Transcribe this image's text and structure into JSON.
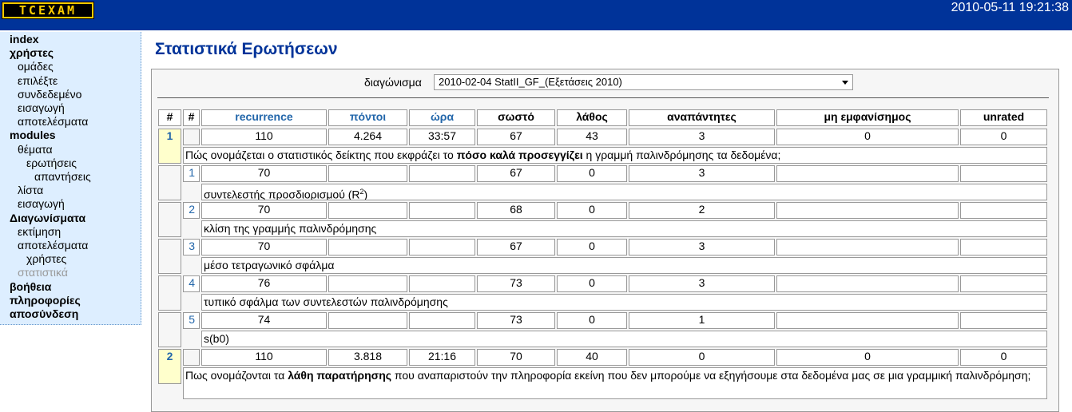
{
  "header": {
    "logo": "TCEXAM",
    "datetime": "2010-05-11 19:21:38"
  },
  "menu": [
    {
      "label": "index",
      "bold": true,
      "indent": 0
    },
    {
      "label": "χρήστες",
      "bold": true,
      "indent": 0
    },
    {
      "label": "ομάδες",
      "indent": 1
    },
    {
      "label": "επιλέξτε",
      "indent": 1
    },
    {
      "label": "συνδεδεμένο",
      "indent": 1
    },
    {
      "label": "εισαγωγή",
      "indent": 1
    },
    {
      "label": "αποτελέσματα",
      "indent": 1
    },
    {
      "label": "modules",
      "bold": true,
      "indent": 0
    },
    {
      "label": "θέματα",
      "indent": 1
    },
    {
      "label": "ερωτήσεις",
      "indent": 2
    },
    {
      "label": "απαντήσεις",
      "indent": 3
    },
    {
      "label": "λίστα",
      "indent": 1
    },
    {
      "label": "εισαγωγή",
      "indent": 1
    },
    {
      "label": "Διαγωνίσματα",
      "bold": true,
      "indent": 0
    },
    {
      "label": "εκτίμηση",
      "indent": 1
    },
    {
      "label": "αποτελέσματα",
      "indent": 1
    },
    {
      "label": "χρήστες",
      "indent": 2
    },
    {
      "label": "στατιστικά",
      "indent": 1,
      "disabled": true
    },
    {
      "label": "βοήθεια",
      "bold": true,
      "indent": 0
    },
    {
      "label": "πληροφορίες",
      "bold": true,
      "indent": 0
    },
    {
      "label": "αποσύνδεση",
      "bold": true,
      "indent": 0
    }
  ],
  "page": {
    "title": "Στατιστικά Ερωτήσεων",
    "test_label": "διαγώνισμα",
    "test_selected": "2010-02-04 StatII_GF_(Εξετάσεις 2010)"
  },
  "table": {
    "headers": [
      "#",
      "#",
      "recurrence",
      "πόντοι",
      "ώρα",
      "σωστό",
      "λάθος",
      "αναπάντητες",
      "μη εμφανίσημος",
      "unrated"
    ],
    "questions": [
      {
        "num": "1",
        "values": [
          "110",
          "4.264",
          "33:57",
          "67",
          "43",
          "3",
          "0",
          "0"
        ],
        "text_before": "Πώς ονομάζεται ο στατιστικός δείκτης που εκφράζει το ",
        "text_bold": "πόσο καλά προσεγγίζει",
        "text_after": " η γραμμή παλινδρόμησης τα δεδομένα;",
        "answers": [
          {
            "num": "1",
            "values": [
              "70",
              "",
              "",
              "67",
              "0",
              "3",
              "",
              ""
            ],
            "text": "συντελεστής προσδιορισμού (R",
            "sup": "2",
            "text_end": ")"
          },
          {
            "num": "2",
            "values": [
              "70",
              "",
              "",
              "68",
              "0",
              "2",
              "",
              ""
            ],
            "text": "κλίση της γραμμής παλινδρόμησης"
          },
          {
            "num": "3",
            "values": [
              "70",
              "",
              "",
              "67",
              "0",
              "3",
              "",
              ""
            ],
            "text": "μέσο τετραγωνικό σφάλμα"
          },
          {
            "num": "4",
            "values": [
              "76",
              "",
              "",
              "73",
              "0",
              "3",
              "",
              ""
            ],
            "text": "τυπικό σφάλμα των συντελεστών παλινδρόμησης"
          },
          {
            "num": "5",
            "values": [
              "74",
              "",
              "",
              "73",
              "0",
              "1",
              "",
              ""
            ],
            "text": "s(b0)"
          }
        ]
      },
      {
        "num": "2",
        "values": [
          "110",
          "3.818",
          "21:16",
          "70",
          "40",
          "0",
          "0",
          "0"
        ],
        "text_before": "Πως ονομάζονται τα ",
        "text_bold": "λάθη παρατήρησης",
        "text_after": " που αναπαριστούν την πληροφορία εκείνη που δεν μπορούμε να εξηγήσουμε στα δεδομένα μας σε μια γραμμική παλινδρόμηση;",
        "answers": []
      }
    ]
  }
}
